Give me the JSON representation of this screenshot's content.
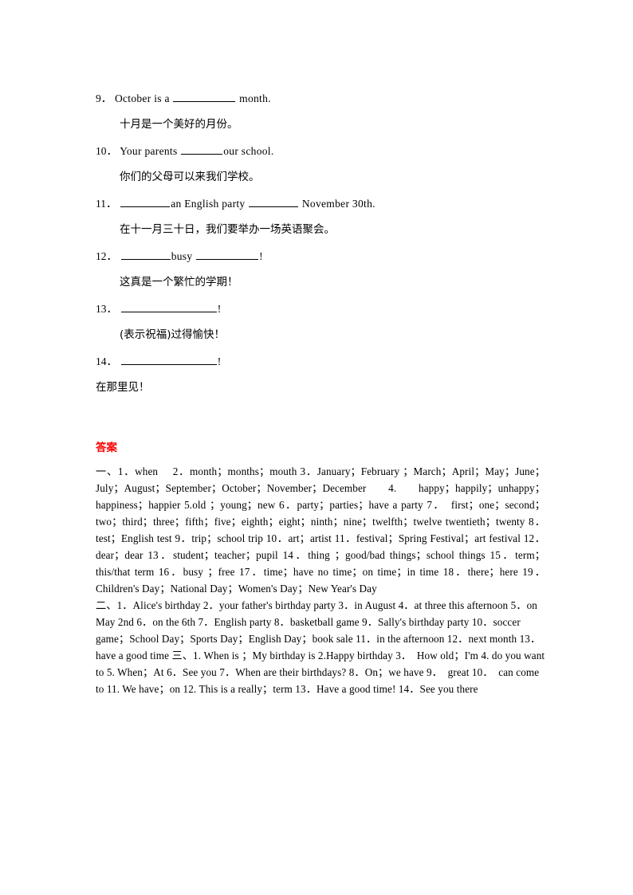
{
  "document": {
    "type": "worksheet-answer-sheet",
    "accent_color": "#ff0000",
    "text_color": "#000000",
    "background_color": "#ffffff"
  },
  "questions": [
    {
      "number": "9．",
      "english_before": "October  is a",
      "english_after": "month.",
      "blank_style": "w-long",
      "chinese": "十月是一个美好的月份。",
      "chinese_indent": true
    },
    {
      "number": "10．",
      "english_before": "Your  parents",
      "english_after": "our  school.",
      "blank_style": "w-med",
      "chinese": "你们的父母可以来我们学校。",
      "chinese_indent": true
    },
    {
      "number": "11．",
      "english_before": "",
      "english_middle": "an  English  party",
      "english_after": "November  30th.",
      "blank_style": "w-short",
      "blank_style2": "w-short",
      "chinese": "在十一月三十日，我们要举办一场英语聚会。",
      "chinese_indent": true
    },
    {
      "number": "12．",
      "english_before": "",
      "english_middle": "busy",
      "english_after": "!",
      "blank_style": "w-short",
      "blank_style2": "w-long",
      "chinese": "这真是一个繁忙的学期！",
      "chinese_indent": true
    },
    {
      "number": "13．",
      "english_before": "",
      "english_after": "!",
      "blank_style": "w-wide",
      "chinese": "(表示祝福)过得愉快！",
      "chinese_indent": true
    },
    {
      "number": "14．",
      "english_before": "",
      "english_after": "!",
      "blank_style": "w-wide",
      "chinese": "在那里见！",
      "chinese_indent": false
    }
  ],
  "answers": {
    "heading": "答案",
    "paragraphs": [
      "一、1．when　 2．month；months；mouth 3．January；February  ；March；April；May；June；July；August；September；October；November；December 4. happy；happily；unhappy；happiness；happier 5.old  ；young；new 6．party；parties；have a party 7．　first；one；second；two；third；three；fifth；five；eighth；eight；ninth；nine；twelfth；twelve twentieth；twenty 8．test；English test  9．trip；school trip  10．art；artist 11．festival；Spring Festival；art festival 12．dear；dear  13．student；teacher；pupil 14．thing  ；good/bad things；school things 15．term；this/that term 16．busy  ；free 17．time；have no time；on time；in time  18．there；here 19．Children's Day；National Day；Women's Day；New Year's Day",
      "二、1．Alice's birthday  2．your father's birthday party 3．in August  4．at three this afternoon  5．on May 2nd 6．on the 6th  7．English party  8．basketball game 9．Sally's birthday party 10．soccer game；School Day；Sports Day；English Day；book sale 11．in the afternoon   12．next month  13．have a good time 三、1. When is ；My birthday is   2.Happy birthday 3．　How old；I'm  4. do you want to  5. When；At 6．See you  7．When are their birthdays?  8．On；we have 9．　great  10．　can come to  11. We have；on 12. This is a really；term  13．Have a good time! 14．See you there"
    ]
  }
}
